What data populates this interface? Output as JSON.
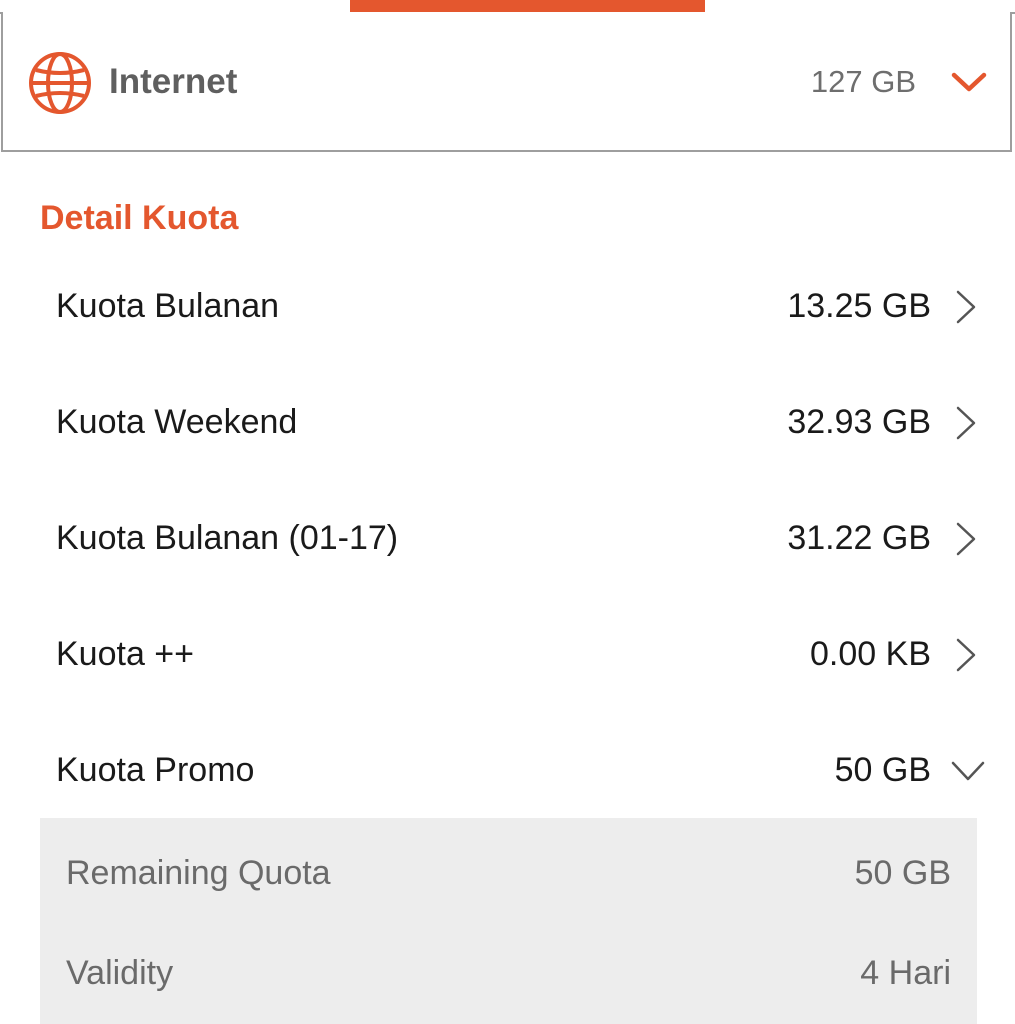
{
  "colors": {
    "accent": "#e4572e",
    "border": "#9e9e9e",
    "panel_bg": "#ededed",
    "text_primary": "#1a1a1a",
    "text_muted": "#6a6a6a"
  },
  "internet": {
    "icon": "globe-icon",
    "title": "Internet",
    "total": "127 GB",
    "expand_icon": "chevron-down-icon"
  },
  "detail": {
    "title": "Detail Kuota",
    "items": [
      {
        "label": "Kuota Bulanan",
        "value": "13.25 GB",
        "icon": "chevron-right-icon"
      },
      {
        "label": "Kuota Weekend",
        "value": "32.93 GB",
        "icon": "chevron-right-icon"
      },
      {
        "label": "Kuota Bulanan (01-17)",
        "value": "31.22 GB",
        "icon": "chevron-right-icon"
      },
      {
        "label": "Kuota ++",
        "value": "0.00 KB",
        "icon": "chevron-right-icon"
      },
      {
        "label": "Kuota Promo",
        "value": "50 GB",
        "icon": "chevron-down-icon"
      }
    ],
    "promo_details": [
      {
        "label": "Remaining Quota",
        "value": "50 GB"
      },
      {
        "label": "Validity",
        "value": "4 Hari"
      }
    ]
  }
}
